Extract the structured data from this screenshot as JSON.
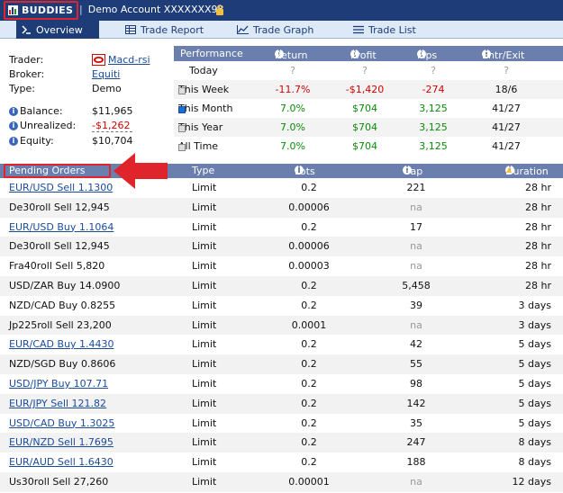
{
  "titlebar": {
    "app_name": "BUDDIES",
    "separator": "|",
    "account": "Demo Account XXXXXXX98"
  },
  "tabs": [
    {
      "label": "Overview",
      "icon": "arrow-icon",
      "active": true
    },
    {
      "label": "Trade Report",
      "icon": "table-icon",
      "active": false
    },
    {
      "label": "Trade Graph",
      "icon": "line-chart-icon",
      "active": false
    },
    {
      "label": "Trade List",
      "icon": "list-icon",
      "active": false
    }
  ],
  "trader": {
    "trader_label": "Trader:",
    "trader_value": "Macd-rsi",
    "broker_label": "Broker:",
    "broker_value": "Equiti",
    "type_label": "Type:",
    "type_value": "Demo",
    "balance_label": "Balance:",
    "balance_value": "$11,965",
    "unrealized_label": "Unrealized:",
    "unrealized_value": "-$1,262",
    "equity_label": "Equity:",
    "equity_value": "$10,704"
  },
  "performance": {
    "headers": [
      "Performance",
      "Return",
      "Profit",
      "Pips",
      "Entr/Exit"
    ],
    "rows": [
      {
        "period": "Today",
        "return": "?",
        "profit": "?",
        "pips": "?",
        "entr_exit": "?",
        "checkbox": "none"
      },
      {
        "period": "This Week",
        "return": "-11.7%",
        "profit": "-$1,420",
        "pips": "-274",
        "entr_exit": "18/6",
        "checkbox": "off"
      },
      {
        "period": "This Month",
        "return": "7.0%",
        "profit": "$704",
        "pips": "3,125",
        "entr_exit": "41/27",
        "checkbox": "on"
      },
      {
        "period": "This Year",
        "return": "7.0%",
        "profit": "$704",
        "pips": "3,125",
        "entr_exit": "41/27",
        "checkbox": "off"
      },
      {
        "period": "All Time",
        "return": "7.0%",
        "profit": "$704",
        "pips": "3,125",
        "entr_exit": "41/27",
        "checkbox": "off"
      }
    ]
  },
  "pending_orders": {
    "headers": [
      "Pending Orders",
      "Type",
      "Lots",
      "Gap",
      "Duration"
    ],
    "rows": [
      {
        "order": "EUR/USD Sell 1.1300",
        "link": true,
        "type": "Limit",
        "lots": "0.2",
        "gap": "221",
        "duration": "28 hr"
      },
      {
        "order": "De30roll Sell 12,945",
        "link": false,
        "type": "Limit",
        "lots": "0.00006",
        "gap": "na",
        "duration": "28 hr"
      },
      {
        "order": "EUR/USD Buy 1.1064",
        "link": true,
        "type": "Limit",
        "lots": "0.2",
        "gap": "17",
        "duration": "28 hr"
      },
      {
        "order": "De30roll Sell 12,945",
        "link": false,
        "type": "Limit",
        "lots": "0.00006",
        "gap": "na",
        "duration": "28 hr"
      },
      {
        "order": "Fra40roll Sell 5,820",
        "link": false,
        "type": "Limit",
        "lots": "0.00003",
        "gap": "na",
        "duration": "28 hr"
      },
      {
        "order": "USD/ZAR Buy 14.0900",
        "link": false,
        "type": "Limit",
        "lots": "0.2",
        "gap": "5,458",
        "duration": "28 hr"
      },
      {
        "order": "NZD/CAD Buy 0.8255",
        "link": false,
        "type": "Limit",
        "lots": "0.2",
        "gap": "39",
        "duration": "3 days"
      },
      {
        "order": "Jp225roll Sell 23,200",
        "link": false,
        "type": "Limit",
        "lots": "0.0001",
        "gap": "na",
        "duration": "3 days"
      },
      {
        "order": "EUR/CAD Buy 1.4430",
        "link": true,
        "type": "Limit",
        "lots": "0.2",
        "gap": "42",
        "duration": "5 days"
      },
      {
        "order": "NZD/SGD Buy 0.8606",
        "link": false,
        "type": "Limit",
        "lots": "0.2",
        "gap": "55",
        "duration": "5 days"
      },
      {
        "order": "USD/JPY Buy 107.71",
        "link": true,
        "type": "Limit",
        "lots": "0.2",
        "gap": "98",
        "duration": "5 days"
      },
      {
        "order": "EUR/JPY Sell 121.82",
        "link": true,
        "type": "Limit",
        "lots": "0.2",
        "gap": "142",
        "duration": "5 days"
      },
      {
        "order": "USD/CAD Buy 1.3025",
        "link": true,
        "type": "Limit",
        "lots": "0.2",
        "gap": "35",
        "duration": "5 days"
      },
      {
        "order": "EUR/NZD Sell 1.7695",
        "link": true,
        "type": "Limit",
        "lots": "0.2",
        "gap": "247",
        "duration": "8 days"
      },
      {
        "order": "EUR/AUD Sell 1.6430",
        "link": true,
        "type": "Limit",
        "lots": "0.2",
        "gap": "188",
        "duration": "8 days"
      },
      {
        "order": "Us30roll Sell 27,260",
        "link": false,
        "type": "Limit",
        "lots": "0.00001",
        "gap": "na",
        "duration": "12 days"
      }
    ]
  },
  "colors": {
    "titlebar": "#1d3c78",
    "header": "#6a7fad",
    "highlight": "#e0242b",
    "positive": "#0a8a0a",
    "negative": "#d40000",
    "link": "#1a4b9b"
  }
}
